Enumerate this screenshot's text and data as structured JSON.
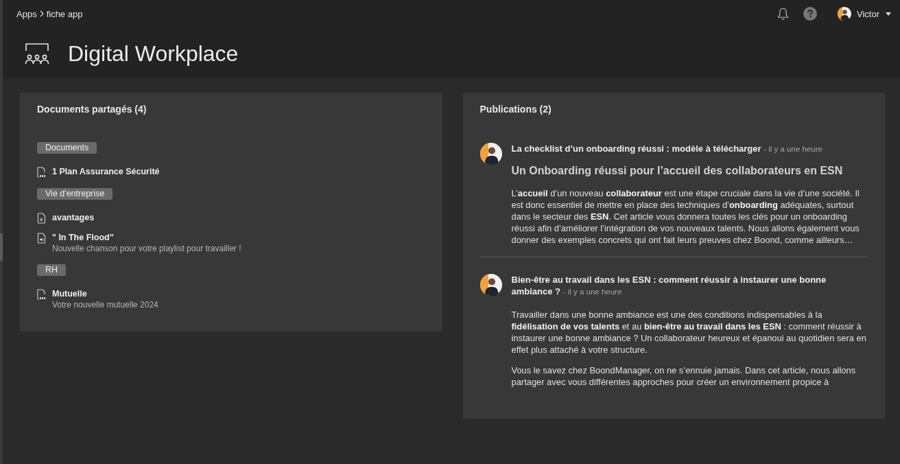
{
  "breadcrumb": [
    {
      "label": "Apps"
    },
    {
      "label": "fiche app"
    }
  ],
  "user": {
    "name": "Victor"
  },
  "page": {
    "title": "Digital Workplace"
  },
  "documents": {
    "title": "Documents partagés (4)",
    "groups": [
      {
        "tag": "Documents",
        "files": [
          {
            "kind": "pdf",
            "name": "1 Plan Assurance Sécurité"
          }
        ]
      },
      {
        "tag": "Vie d'entreprise",
        "files": [
          {
            "kind": "spreadsheet",
            "name": "avantages"
          },
          {
            "kind": "audio",
            "name": "\" In The Flood\"",
            "description": "Nouvelle chanson pour votre playlist pour travailler !"
          }
        ]
      },
      {
        "tag": "RH",
        "files": [
          {
            "kind": "pdf",
            "name": "Mutuelle",
            "description": "Votre nouvelle mutuelle 2024"
          }
        ]
      }
    ]
  },
  "publications": {
    "title": "Publications (2)",
    "posts": [
      {
        "title": "La checklist d’un onboarding réussi : modèle à télécharger",
        "time": "- il y a une heure",
        "heading": "Un Onboarding réussi pour l’accueil des collaborateurs en ESN",
        "paragraphs": [
          "L’**accueil** d’un nouveau **collaborateur** est une étape cruciale dans la vie d’une société. Il est donc essentiel de mettre en place des techniques d’**onboarding** adéquates, surtout dans le secteur des **ESN**. Cet article vous donnera toutes les clés pour un onboarding réussi afin d’améliorer l’intégration de vos nouveaux talents. Nous allons également vous donner des exemples concrets qui ont fait leurs preuves chez Boond, comme ailleurs…"
        ]
      },
      {
        "title": "Bien-être au travail dans les ESN : comment réussir à instaurer une bonne ambiance ?",
        "time": "- il y a une heure",
        "paragraphs": [
          "Travailler dans une bonne ambiance est une des conditions indispensables à la **fidélisation de vos talents** et au **bien-être au travail dans les ESN** : comment réussir à instaurer une bonne ambiance ? Un collaborateur heureux et épanoui au quotidien sera en effet plus attaché à votre structure.",
          "Vous le savez chez BoondManager, on ne s’ennuie jamais. Dans cet article, nous allons partager avec vous différentes approches pour créer un environnement propice à"
        ]
      }
    ]
  }
}
